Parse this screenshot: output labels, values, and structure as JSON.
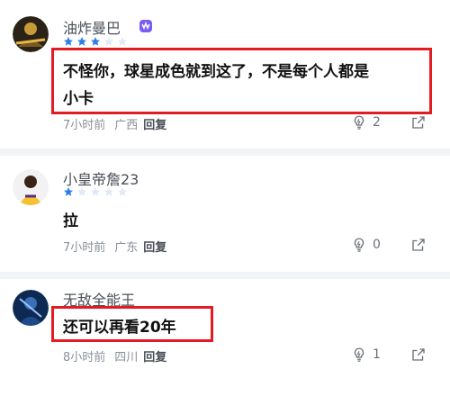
{
  "comments": [
    {
      "username": "油炸曼巴",
      "rating_filled": 3,
      "rating_total": 5,
      "text_line1": "不怪你，球星成色就到这了，不是每个人都是",
      "text_line2": "小卡",
      "time": "7小时前",
      "location": "广西",
      "reply_label": "回复",
      "like_count": "2",
      "has_vip_badge": true
    },
    {
      "username": "小皇帝詹23",
      "rating_filled": 1,
      "rating_total": 5,
      "text_line1": "拉",
      "time": "7小时前",
      "location": "广东",
      "reply_label": "回复",
      "like_count": "0"
    },
    {
      "username": "无敌全能王",
      "text_line1": "还可以再看20年",
      "time": "8小时前",
      "location": "四川",
      "reply_label": "回复",
      "like_count": "1"
    }
  ],
  "colors": {
    "highlight_border": "#e31b23",
    "star_filled": "#2b7de9",
    "star_empty": "#dfe9f8",
    "vip_badge": "#7b5cf0"
  },
  "icons": [
    "lightbulb-icon",
    "share-icon",
    "star-icon",
    "vip-badge-icon"
  ]
}
